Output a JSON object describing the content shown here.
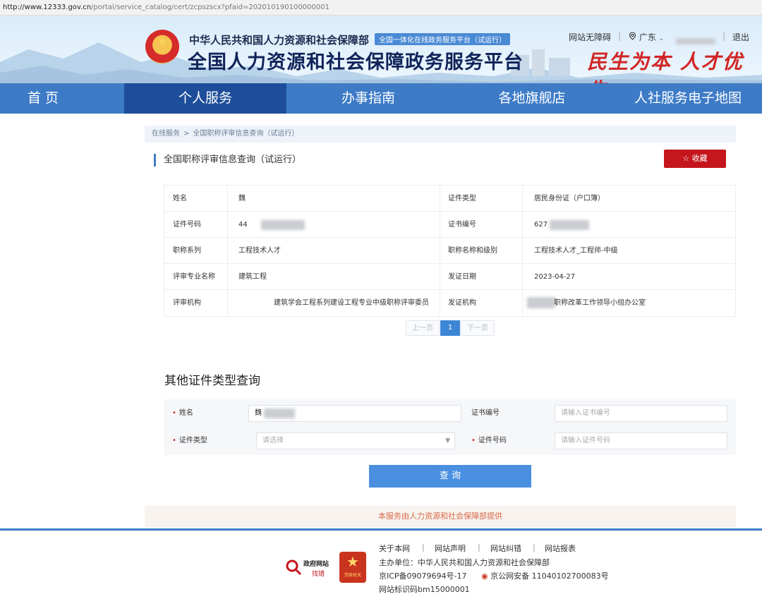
{
  "browser": {
    "url_host": "http://www.12333.gov.cn",
    "url_path": "/portal/service_catalog/cert/zcpszscx?pfaid=202010190100000001"
  },
  "header": {
    "department": "中华人民共和国人力资源和社会保障部",
    "tag": "全国一体化在线政务服务平台（试运行）",
    "site_title": "全国人力资源和社会保障政务服务平台",
    "accessibility": "网站无障碍",
    "region": "广东",
    "logout": "退出",
    "slogan": "民生为本 人才优先"
  },
  "nav": {
    "items": [
      "首 页",
      "个人服务",
      "办事指南",
      "各地旗舰店",
      "人社服务电子地图"
    ],
    "active_index": 1
  },
  "breadcrumb": {
    "root": "在线服务",
    "separator": ">",
    "current": "全国职称评审信息查询（试运行）"
  },
  "section": {
    "title": "全国职称评审信息查询（试运行）",
    "favorite_icon": "star-outline-icon",
    "favorite_label": "收藏"
  },
  "info_table": {
    "rows": [
      {
        "l1": "姓名",
        "v1": "魏",
        "l2": "证件类型",
        "v2": "居民身份证（户口簿）"
      },
      {
        "l1": "证件号码",
        "v1": "44",
        "l2": "证书编号",
        "v2": "627"
      },
      {
        "l1": "职称系列",
        "v1": "工程技术人才",
        "l2": "职称名称和级别",
        "v2": "工程技术人才_工程师-中级"
      },
      {
        "l1": "评审专业名称",
        "v1": "建筑工程",
        "l2": "发证日期",
        "v2": "2023-04-27"
      },
      {
        "l1": "评审机构",
        "v1": "建筑学会工程系列建设工程专业中级职称评审委员",
        "l2": "发证机构",
        "v2": "职称改革工作领导小组办公室"
      }
    ]
  },
  "pagination": {
    "prev": "上一页",
    "current": "1",
    "next": "下一页"
  },
  "other_query": {
    "title": "其他证件类型查询",
    "required_mark": "•",
    "name_label": "姓名",
    "name_value": "魏",
    "cert_no_label": "证书编号",
    "cert_no_placeholder": "请输入证书编号",
    "id_type_label": "证件类型",
    "id_type_placeholder": "请选择",
    "id_no_label": "证件号码",
    "id_no_placeholder": "请输入证件号码",
    "submit": "查 询"
  },
  "provider_note": "本服务由人力资源和社会保障部提供",
  "footer": {
    "links": [
      "关于本网",
      "网站声明",
      "网站纠错",
      "网站报表"
    ],
    "link_separator": "|",
    "sponsor": "主办单位：中华人民共和国人力资源和社会保障部",
    "icp": "京ICP备09079694号-17",
    "police": "京公网安备 11040102700083号",
    "site_id": "网站标识码bm15000001",
    "badge_gov_line1": "政府网站",
    "badge_gov_line2": "找错",
    "badge_party": "党政机关"
  },
  "colors": {
    "nav_bg": "#3d7bc7",
    "nav_active": "#1e4e9a",
    "favorite_red": "#c4161c",
    "query_button": "#4a8fe0",
    "provider_text": "#d96a4a"
  }
}
